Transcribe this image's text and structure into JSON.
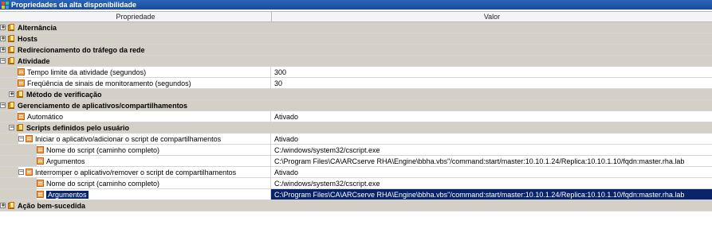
{
  "window": {
    "title": "Propriedades da alta disponibilidade"
  },
  "columns": {
    "property": "Propriedade",
    "value": "Valor"
  },
  "rows": [
    {
      "label": "Alternância",
      "value": "",
      "type": "group",
      "expander": "+"
    },
    {
      "label": "Hosts",
      "value": "",
      "type": "group",
      "expander": "+"
    },
    {
      "label": "Redirecionamento do tráfego da rede",
      "value": "",
      "type": "group",
      "expander": "+"
    },
    {
      "label": "Atividade",
      "value": "",
      "type": "group",
      "expander": "−"
    },
    {
      "label": "Tempo limite da atividade (segundos)",
      "value": "300",
      "type": "item"
    },
    {
      "label": "Freqüência de sinais de monitoramento (segundos)",
      "value": "30",
      "type": "item"
    },
    {
      "label": "Método de verificação",
      "value": "",
      "type": "subgroup",
      "expander": "+"
    },
    {
      "label": "Gerenciamento de aplicativos/compartilhamentos",
      "value": "",
      "type": "group",
      "expander": "−"
    },
    {
      "label": "Automático",
      "value": "Ativado",
      "type": "item"
    },
    {
      "label": "Scripts definidos pelo usuário",
      "value": "",
      "type": "subgroup",
      "expander": "−"
    },
    {
      "label": "Iniciar o aplicativo/adicionar o script de compartilhamentos",
      "value": "Ativado",
      "type": "item-exp",
      "expander": "−"
    },
    {
      "label": "Nome do script (caminho completo)",
      "value": "C:/windows/system32/cscript.exe",
      "type": "item-deep"
    },
    {
      "label": "Argumentos",
      "value": "C:\\Program Files\\CA\\ARCserve RHA\\Engine\\bbha.vbs\"/command:start/master:10.10.1.24/Replica:10.10.1.10/fqdn:master.rha.lab",
      "type": "item-deep"
    },
    {
      "label": "Interromper o aplicativo/remover o script de compartilhamentos",
      "value": "Ativado",
      "type": "item-exp",
      "expander": "−"
    },
    {
      "label": "Nome do script (caminho completo)",
      "value": "C:/windows/system32/cscript.exe",
      "type": "item-deep"
    },
    {
      "label": "Argumentos",
      "value": "C:\\Program Files\\CA\\ARCserve RHA\\Engine\\bbha.vbs\"/command:start/master:10.10.1.24/Replica:10.10.1.10/fqdn:master.rha.lab",
      "type": "item-deep",
      "selected": true
    },
    {
      "label": "Ação bem-sucedida",
      "value": "",
      "type": "group",
      "expander": "+"
    }
  ]
}
